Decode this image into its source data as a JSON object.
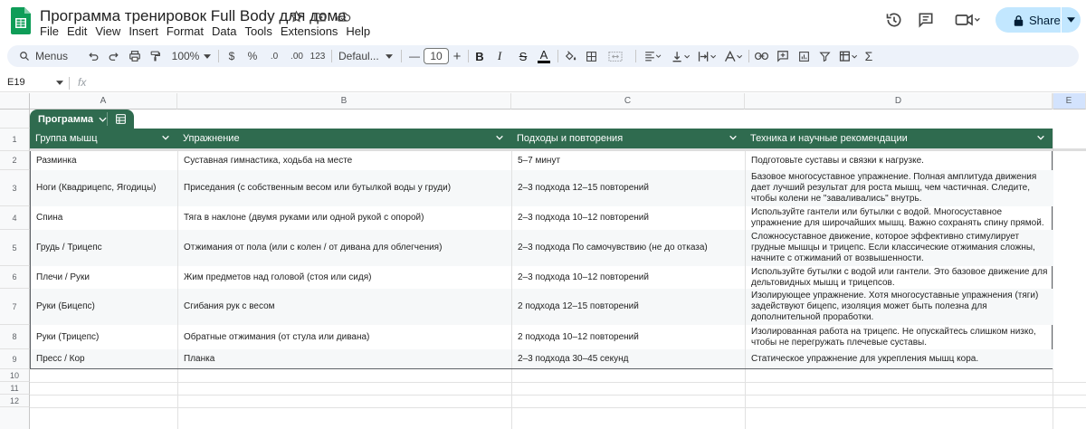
{
  "app": {
    "doc_title": "Программа тренировок Full Body для дома",
    "menu": [
      "File",
      "Edit",
      "View",
      "Insert",
      "Format",
      "Data",
      "Tools",
      "Extensions",
      "Help"
    ],
    "share_label": "Share",
    "brand_color": "#0f9d58",
    "accent_color": "#c2e7ff"
  },
  "toolbar": {
    "menus_label": "Menus",
    "zoom": "100%",
    "currency": "$",
    "percent": "%",
    "dec_decrease": ".0",
    "dec_increase": ".00",
    "number_format": "123",
    "font": "Defaul...",
    "font_size": "10",
    "bold": "B",
    "italic": "I",
    "strike": "S",
    "text_color": "A",
    "sum": "Σ",
    "minus": "—",
    "plus": "+"
  },
  "formula_bar": {
    "name_box": "E19",
    "fx": "fx",
    "content": ""
  },
  "grid": {
    "columns": [
      "A",
      "B",
      "C",
      "D",
      "E"
    ],
    "rows": [
      "1",
      "2",
      "3",
      "4",
      "5",
      "6",
      "7",
      "8",
      "9",
      "10",
      "11",
      "12"
    ]
  },
  "table": {
    "name": "Программа",
    "header_color": "#2f6b4f",
    "headers": [
      "Группа мышц",
      "Упражнение",
      "Подходы и повторения",
      "Техника и научные рекомендации"
    ],
    "rows": [
      [
        "Разминка",
        "Суставная гимнастика, ходьба на месте",
        "5–7 минут",
        "Подготовьте суставы и связки к нагрузке."
      ],
      [
        "Ноги (Квадрицепс, Ягодицы)",
        "Приседания (с собственным весом или бутылкой воды у груди)",
        "2–3 подхода  12–15 повторений",
        "Базовое многосуставное упражнение. Полная амплитуда движения дает лучший результат для роста мышц, чем частичная. Следите, чтобы колени не \"заваливались\" внутрь."
      ],
      [
        "Спина",
        "Тяга в наклоне (двумя руками или одной рукой с опорой)",
        "2–3 подхода  10–12 повторений",
        "Используйте гантели или бутылки с водой. Многосуставное упражнение для широчайших мышц. Важно сохранять спину прямой."
      ],
      [
        "Грудь / Трицепс",
        "Отжимания от пола (или с колен / от дивана для облегчения)",
        "2–3 подхода  По самочувствию (не до отказа)",
        "Сложносуставное движение, которое эффективно стимулирует грудные мышцы и трицепс. Если классические отжимания сложны, начните с отжиманий от возвышенности."
      ],
      [
        "Плечи / Руки",
        "Жим предметов над головой (стоя или сидя)",
        "2–3 подхода  10–12 повторений",
        "Используйте бутылки с водой или гантели. Это базовое движение для дельтовидных мышц и трицепсов."
      ],
      [
        "Руки (Бицепс)",
        "Сгибания рук с весом",
        "2 подхода  12–15 повторений",
        "Изолирующее упражнение. Хотя многосуставные упражнения (тяги) задействуют бицепс, изоляция может быть полезна для дополнительной проработки."
      ],
      [
        "Руки (Трицепс)",
        "Обратные отжимания (от стула или дивана)",
        "2 подхода  10–12 повторений",
        "Изолированная работа на трицепс. Не опускайтесь слишком низко, чтобы не перегружать плечевые суставы."
      ],
      [
        "Пресс / Кор",
        "Планка",
        "2–3 подхода  30–45 секунд",
        "Статическое упражнение для укрепления мышц кора."
      ]
    ]
  }
}
